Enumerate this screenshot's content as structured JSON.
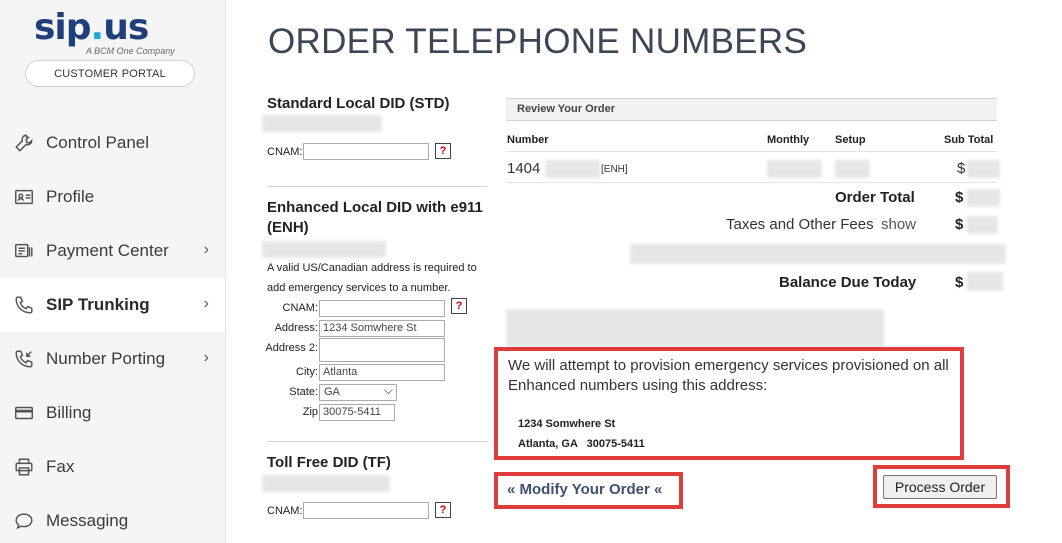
{
  "logo": {
    "main": "sip",
    "dot": ".",
    "suffix": "us",
    "sub": "A BCM One Company"
  },
  "portal_button": "CUSTOMER PORTAL",
  "nav": [
    {
      "label": "Control Panel",
      "icon": "wrench-icon",
      "chevron": false,
      "active": false
    },
    {
      "label": "Profile",
      "icon": "id-card-icon",
      "chevron": false,
      "active": false
    },
    {
      "label": "Payment Center",
      "icon": "payment-icon",
      "chevron": true,
      "active": false
    },
    {
      "label": "SIP Trunking",
      "icon": "phone-icon",
      "chevron": true,
      "active": true
    },
    {
      "label": "Number Porting",
      "icon": "phone-incoming-icon",
      "chevron": true,
      "active": false
    },
    {
      "label": "Billing",
      "icon": "credit-card-icon",
      "chevron": false,
      "active": false
    },
    {
      "label": "Fax",
      "icon": "printer-icon",
      "chevron": false,
      "active": false
    },
    {
      "label": "Messaging",
      "icon": "chat-bubble-icon",
      "chevron": false,
      "active": false
    }
  ],
  "chevron_glyph": "›",
  "page_title": "ORDER TELEPHONE NUMBERS",
  "std": {
    "title": "Standard Local DID (STD)",
    "cnam_label": "CNAM:",
    "cnam_value": ""
  },
  "enh": {
    "title_line1": "Enhanced Local DID with e911",
    "title_line2": "(ENH)",
    "note_line1": "A valid US/Canadian address is required to",
    "note_line2": "add emergency services to a number.",
    "cnam_label": "CNAM:",
    "cnam_value": "",
    "address_label": "Address:",
    "address_value": "1234 Somwhere St",
    "address2_label": "Address 2:",
    "address2_value": "",
    "city_label": "City:",
    "city_value": "Atlanta",
    "state_label": "State:",
    "state_value": "GA",
    "zip_label": "Zip",
    "zip_value": "30075-5411"
  },
  "tf": {
    "title": "Toll Free DID (TF)",
    "cnam_label": "CNAM:",
    "cnam_value": ""
  },
  "help_glyph": "?",
  "review": {
    "header": "Review Your Order",
    "col_number": "Number",
    "col_monthly": "Monthly",
    "col_setup": "Setup",
    "col_subtotal": "Sub Total",
    "row_number": "1404",
    "row_tag": "[ENH]",
    "currency": "$",
    "order_total_label": "Order Total",
    "taxes_label": "Taxes and Other Fees",
    "taxes_link": "show",
    "balance_label": "Balance Due Today"
  },
  "emergency": {
    "message": "We will attempt to provision emergency services provisioned on all Enhanced numbers using this address:",
    "address_line1": "1234 Somwhere St",
    "address_line2": "Atlanta, GA   30075-5411"
  },
  "modify_link": "« Modify Your Order «",
  "process_button": "Process Order",
  "colors": {
    "brand_navy": "#1f3f7a",
    "brand_cyan": "#19a9d8",
    "highlight_red": "#e03c3c",
    "title_slate": "#3c4654"
  }
}
